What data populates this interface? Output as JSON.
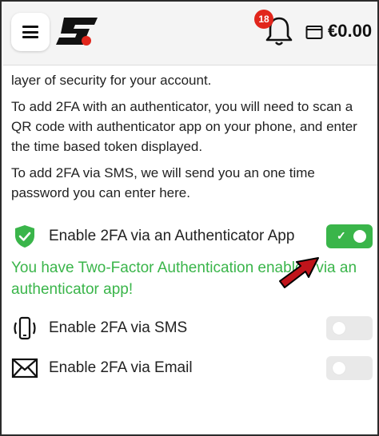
{
  "header": {
    "menu_icon": "hamburger-menu-icon",
    "logo_icon": "brand-logo-icon",
    "notifications": {
      "icon": "bell-icon",
      "count": "18"
    },
    "wallet_icon": "wallet-icon",
    "balance": "€0.00"
  },
  "content": {
    "cut_text": "... ... ... ...",
    "intro_tail": "layer of security for your account.",
    "authenticator_text": "To add 2FA with an authenticator, you will need to scan a QR code with authenticator app on your phone, and enter the time based token displayed.",
    "sms_text": "To add 2FA via SMS, we will send you an one time password you can enter here."
  },
  "options": {
    "authenticator": {
      "label": "Enable 2FA via an Authenticator App",
      "icon": "shield-check-icon",
      "enabled": true,
      "toggle_mark": "✓"
    },
    "sms": {
      "label": "Enable 2FA via SMS",
      "icon": "phone-vibrate-icon",
      "enabled": false
    },
    "email": {
      "label": "Enable 2FA via Email",
      "icon": "envelope-icon",
      "enabled": false
    }
  },
  "status": {
    "message": "You have Two-Factor Authentication enabled via an authenticator app!"
  },
  "colors": {
    "accent_green": "#3ab54a",
    "badge_red": "#e1261c",
    "arrow_red": "#c0141b"
  }
}
